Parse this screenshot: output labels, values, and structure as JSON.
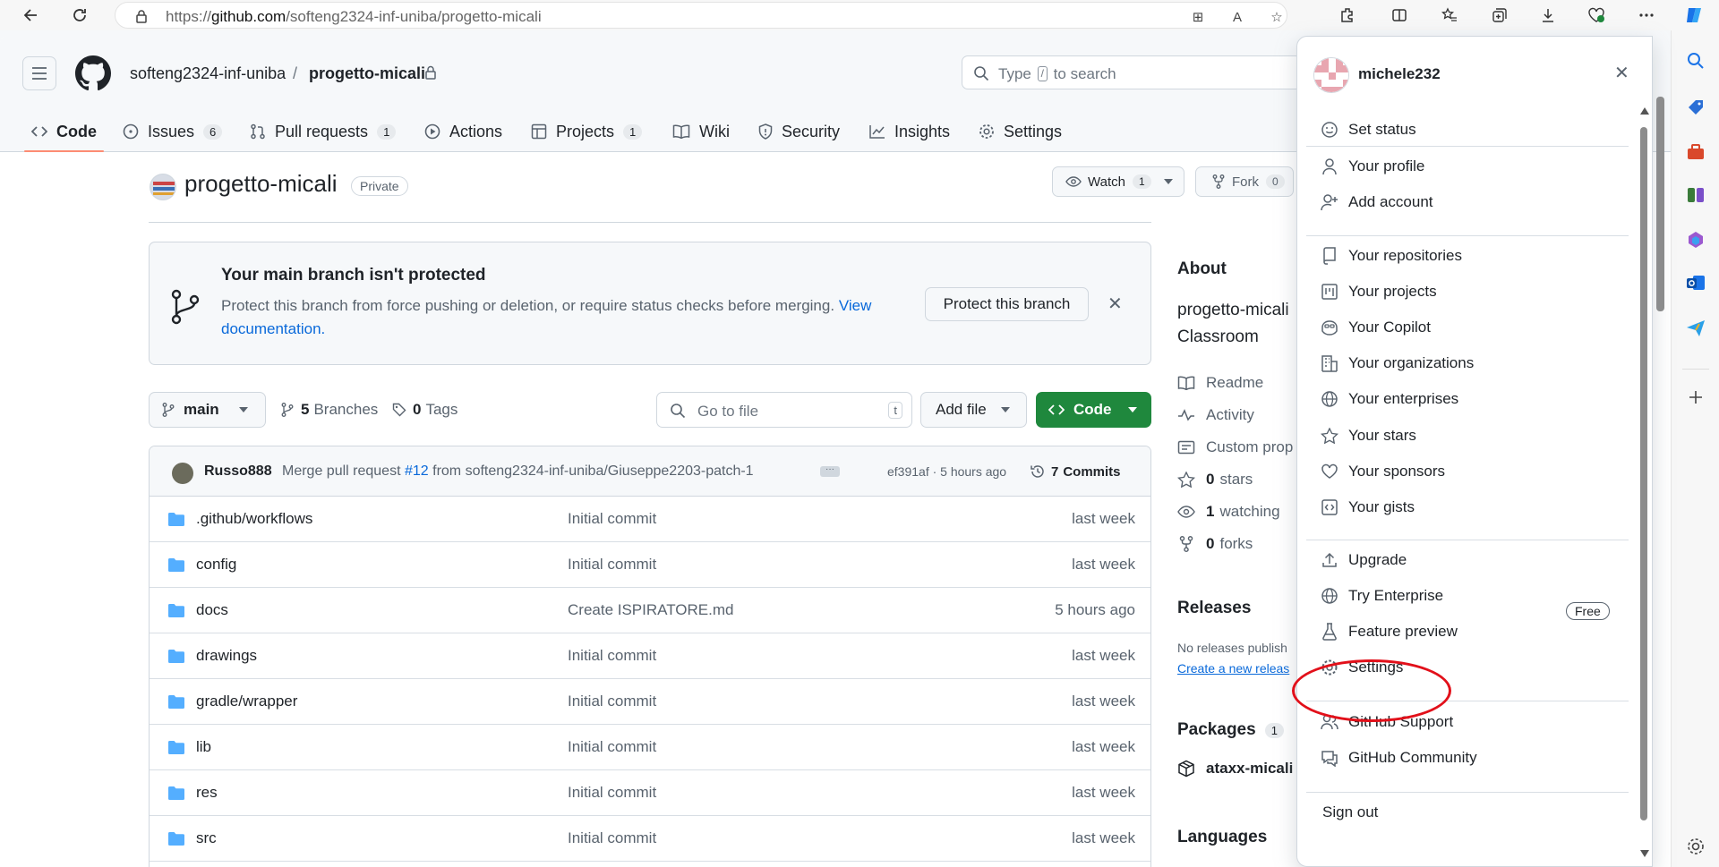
{
  "browser": {
    "url_prefix": "https://",
    "url_domain": "github.com",
    "url_path": "/softeng2324-inf-uniba/progetto-micali"
  },
  "header": {
    "owner": "softeng2324-inf-uniba",
    "separator": "/",
    "repo": "progetto-micali",
    "search_before": "Type",
    "search_key": "/",
    "search_after": "to search"
  },
  "tabs": [
    {
      "label": "Code",
      "count": null,
      "icon": "code-icon"
    },
    {
      "label": "Issues",
      "count": "6",
      "icon": "issue-icon"
    },
    {
      "label": "Pull requests",
      "count": "1",
      "icon": "pull-request-icon"
    },
    {
      "label": "Actions",
      "count": null,
      "icon": "play-icon"
    },
    {
      "label": "Projects",
      "count": "1",
      "icon": "table-icon"
    },
    {
      "label": "Wiki",
      "count": null,
      "icon": "book-icon"
    },
    {
      "label": "Security",
      "count": null,
      "icon": "shield-icon"
    },
    {
      "label": "Insights",
      "count": null,
      "icon": "graph-icon"
    },
    {
      "label": "Settings",
      "count": null,
      "icon": "gear-icon"
    }
  ],
  "repo": {
    "title": "progetto-micali",
    "visibility": "Private",
    "watch_label": "Watch",
    "watch_count": "1",
    "fork_label": "Fork",
    "fork_count": "0"
  },
  "banner": {
    "title": "Your main branch isn't protected",
    "desc": "Protect this branch from force pushing or deletion, or require status checks before merging.",
    "link": "View documentation.",
    "button": "Protect this branch",
    "close": "✕"
  },
  "toolbar": {
    "branch": "main",
    "branches_count": "5",
    "branches_label": "Branches",
    "tags_count": "0",
    "tags_label": "Tags",
    "goto_placeholder": "Go to file",
    "goto_key": "t",
    "add_file": "Add file",
    "code": "Code"
  },
  "commit": {
    "author": "Russo888",
    "message_prefix": "Merge pull request",
    "pr_link": "#12",
    "message_suffix": "from softeng2324-inf-uniba/Giuseppe2203-patch-1",
    "hash_time": "ef391af · 5 hours ago",
    "commits_count": "7",
    "commits_label": "Commits"
  },
  "files": [
    {
      "name": ".github/workflows",
      "message": "Initial commit",
      "date": "last week"
    },
    {
      "name": "config",
      "message": "Initial commit",
      "date": "last week"
    },
    {
      "name": "docs",
      "message": "Create ISPIRATORE.md",
      "date": "5 hours ago"
    },
    {
      "name": "drawings",
      "message": "Initial commit",
      "date": "last week"
    },
    {
      "name": "gradle/wrapper",
      "message": "Initial commit",
      "date": "last week"
    },
    {
      "name": "lib",
      "message": "Initial commit",
      "date": "last week"
    },
    {
      "name": "res",
      "message": "Initial commit",
      "date": "last week"
    },
    {
      "name": "src",
      "message": "Initial commit",
      "date": "last week"
    }
  ],
  "about": {
    "heading": "About",
    "desc_line1": "progetto-micali",
    "desc_line2": "Classroom",
    "readme": "Readme",
    "activity": "Activity",
    "custom_props": "Custom prop",
    "stars_count": "0",
    "stars_label": "stars",
    "watching_count": "1",
    "watching_label": "watching",
    "forks_count": "0",
    "forks_label": "forks",
    "releases_heading": "Releases",
    "releases_none": "No releases publish",
    "releases_create": "Create a new releas",
    "packages_heading": "Packages",
    "packages_count": "1",
    "package_name": "ataxx-micali",
    "languages_heading": "Languages"
  },
  "menu": {
    "username": "michele232",
    "close": "✕",
    "items": [
      {
        "label": "Set status",
        "icon": "smiley-icon"
      },
      {
        "label": "Your profile",
        "icon": "person-icon"
      },
      {
        "label": "Add account",
        "icon": "person-add-icon"
      },
      {
        "label": "Your repositories",
        "icon": "repo-icon"
      },
      {
        "label": "Your projects",
        "icon": "project-icon"
      },
      {
        "label": "Your Copilot",
        "icon": "copilot-icon"
      },
      {
        "label": "Your organizations",
        "icon": "organization-icon"
      },
      {
        "label": "Your enterprises",
        "icon": "globe-icon"
      },
      {
        "label": "Your stars",
        "icon": "star-icon"
      },
      {
        "label": "Your sponsors",
        "icon": "heart-icon"
      },
      {
        "label": "Your gists",
        "icon": "code-square-icon"
      },
      {
        "label": "Upgrade",
        "icon": "upload-icon"
      },
      {
        "label": "Try Enterprise",
        "icon": "globe-icon"
      },
      {
        "label": "Feature preview",
        "icon": "beaker-icon"
      },
      {
        "label": "Settings",
        "icon": "gear-icon"
      },
      {
        "label": "GitHub Support",
        "icon": "people-icon"
      },
      {
        "label": "GitHub Community",
        "icon": "comment-icon"
      },
      {
        "label": "Sign out",
        "icon": null
      }
    ],
    "free_badge": "Free"
  }
}
